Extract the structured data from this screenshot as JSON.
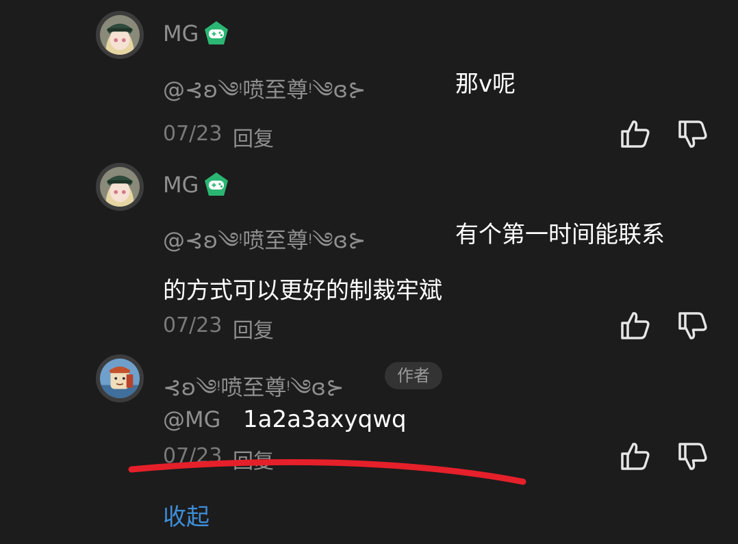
{
  "comments": [
    {
      "username": "MG",
      "mention": "@⊰ʚ༄ᵎ喷至尊ᵎ༄ɞ⊱",
      "text": "那v呢",
      "date": "07/23",
      "reply": "回复"
    },
    {
      "username": "MG",
      "mention": "@⊰ʚ༄ᵎ喷至尊ᵎ༄ɞ⊱",
      "text_line1": "有个第一时间能联系",
      "text_line2": "的方式可以更好的制裁牢斌",
      "date": "07/23",
      "reply": "回复"
    },
    {
      "username": "⊰ʚ༄ᵎ喷至尊ᵎ༄ɞ⊱",
      "author_tag": "作者",
      "mention": "@MG",
      "text": "1a2a3axyqwq",
      "date": "07/23",
      "reply": "回复"
    }
  ],
  "collapse_label": "收起",
  "icons": {
    "badge": "game-controller-badge-icon",
    "like": "thumbs-up-icon",
    "dislike": "thumbs-down-icon"
  },
  "colors": {
    "background": "#1c1c1c",
    "badge": "#2bb673",
    "link": "#3e8ed9",
    "annotation": "#e5202a"
  }
}
